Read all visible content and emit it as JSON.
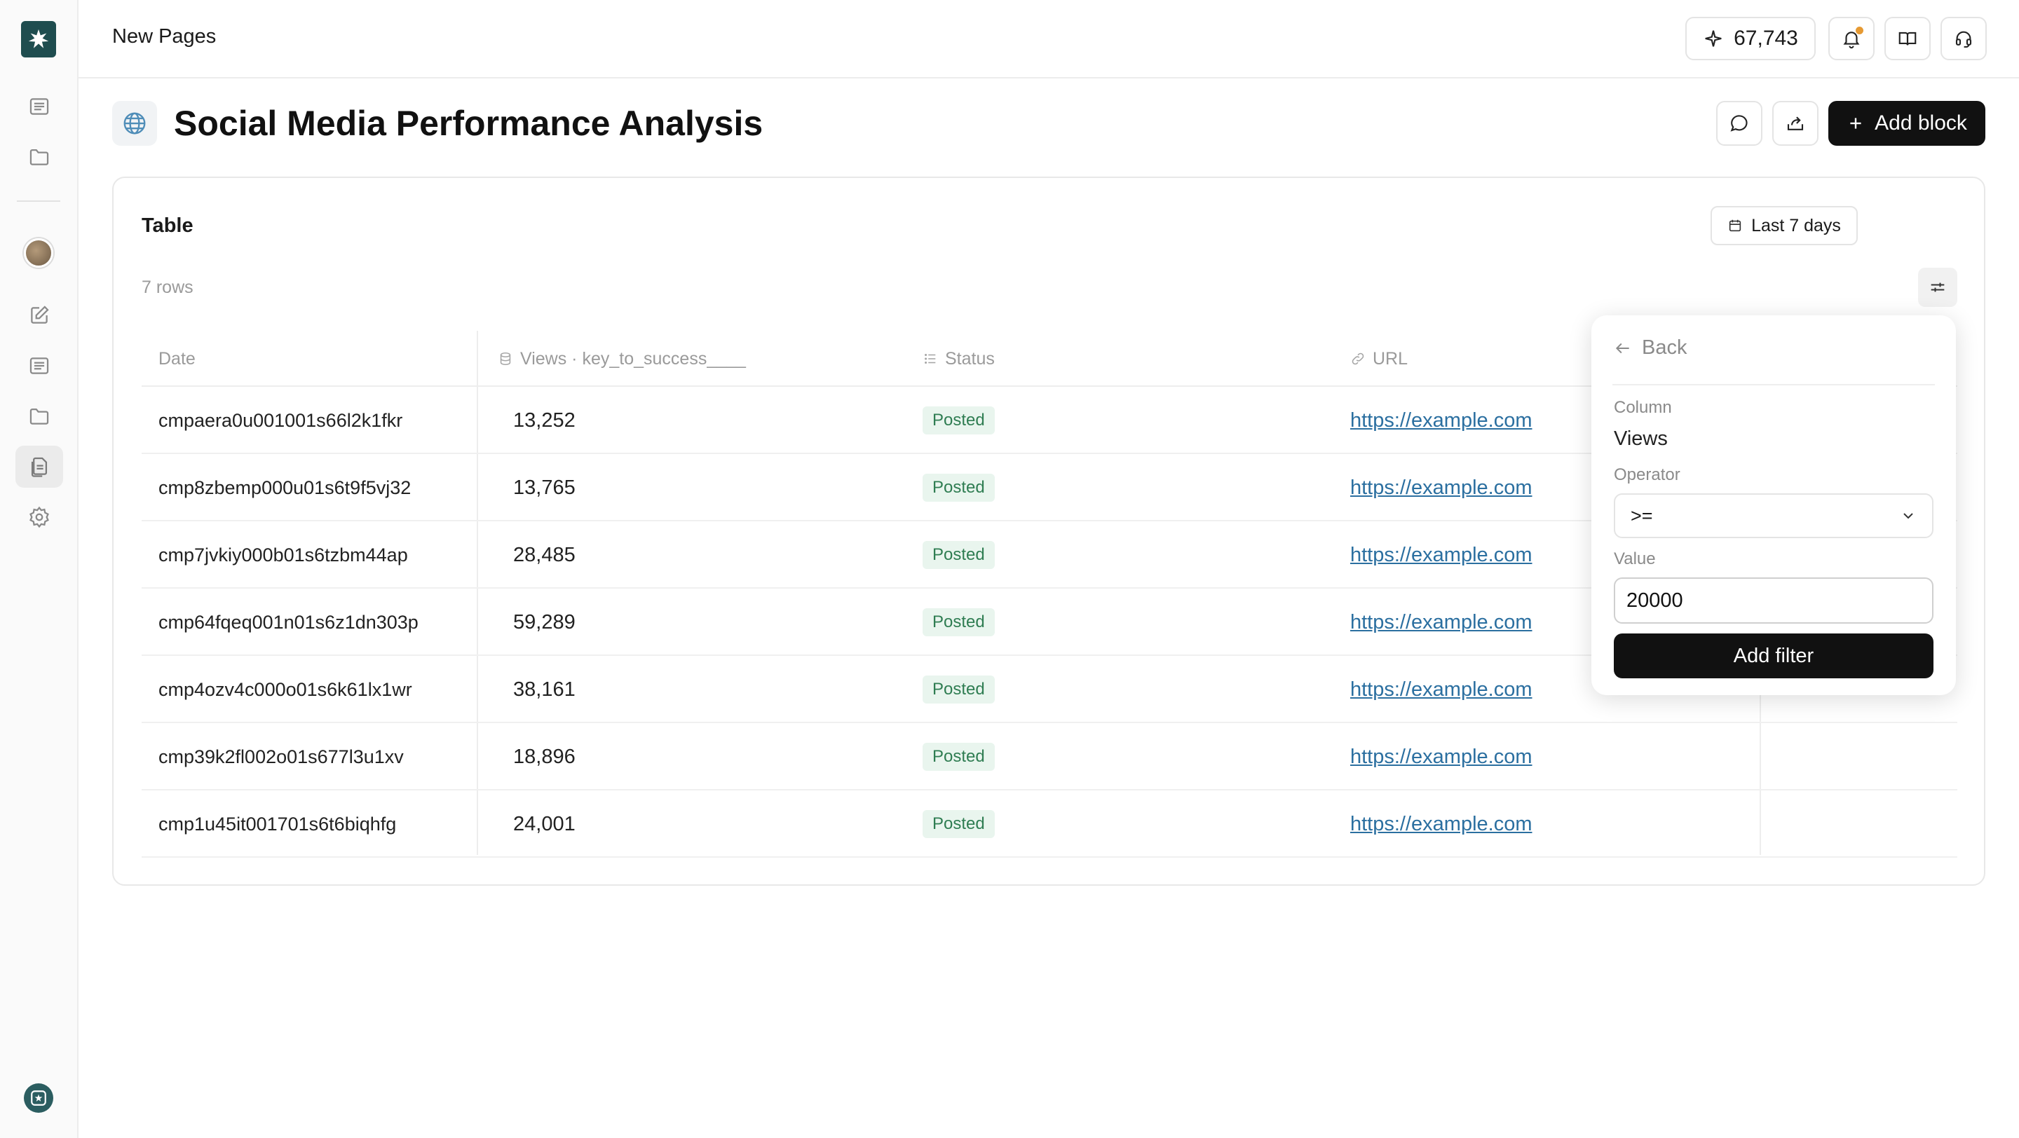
{
  "header": {
    "title": "New Pages",
    "credits": "67,743"
  },
  "page": {
    "title": "Social Media Performance Analysis",
    "add_block_label": "Add block"
  },
  "card": {
    "title": "Table",
    "row_count": "7 rows",
    "date_range": "Last 7 days"
  },
  "table": {
    "columns": [
      "Date",
      "Views · key_to_success____",
      "Status",
      "URL"
    ],
    "rows": [
      {
        "date": "cmpaera0u001001s66l2k1fkr",
        "views": "13,252",
        "status": "Posted",
        "url": "https://example.com"
      },
      {
        "date": "cmp8zbemp000u01s6t9f5vj32",
        "views": "13,765",
        "status": "Posted",
        "url": "https://example.com"
      },
      {
        "date": "cmp7jvkiy000b01s6tzbm44ap",
        "views": "28,485",
        "status": "Posted",
        "url": "https://example.com"
      },
      {
        "date": "cmp64fqeq001n01s6z1dn303p",
        "views": "59,289",
        "status": "Posted",
        "url": "https://example.com"
      },
      {
        "date": "cmp4ozv4c000o01s6k61lx1wr",
        "views": "38,161",
        "status": "Posted",
        "url": "https://example.com"
      },
      {
        "date": "cmp39k2fl002o01s677l3u1xv",
        "views": "18,896",
        "status": "Posted",
        "url": "https://example.com"
      },
      {
        "date": "cmp1u45it001701s6t6biqhfg",
        "views": "24,001",
        "status": "Posted",
        "url": "https://example.com"
      }
    ]
  },
  "filter": {
    "back_label": "Back",
    "column_label": "Column",
    "column_value": "Views",
    "operator_label": "Operator",
    "operator_value": ">=",
    "value_label": "Value",
    "value_input": "20000",
    "submit_label": "Add filter"
  },
  "colors": {
    "brand": "#1f4d4f",
    "primary_button": "#111111",
    "badge_bg": "#e9f5ee",
    "badge_text": "#2f7d52",
    "link": "#2b6fa0",
    "notification_dot": "#e69a33"
  },
  "icons": {
    "sidebar": [
      "list-icon",
      "folder-icon",
      "edit-icon",
      "list-icon",
      "folder-icon",
      "document-icon",
      "gear-icon"
    ],
    "header": [
      "sparkle-icon",
      "bell-icon",
      "book-icon",
      "headset-icon"
    ],
    "page": [
      "globe-icon",
      "comment-icon",
      "share-icon",
      "plus-icon"
    ],
    "table_columns": [
      "database-icon",
      "list-icon",
      "link-icon"
    ]
  }
}
